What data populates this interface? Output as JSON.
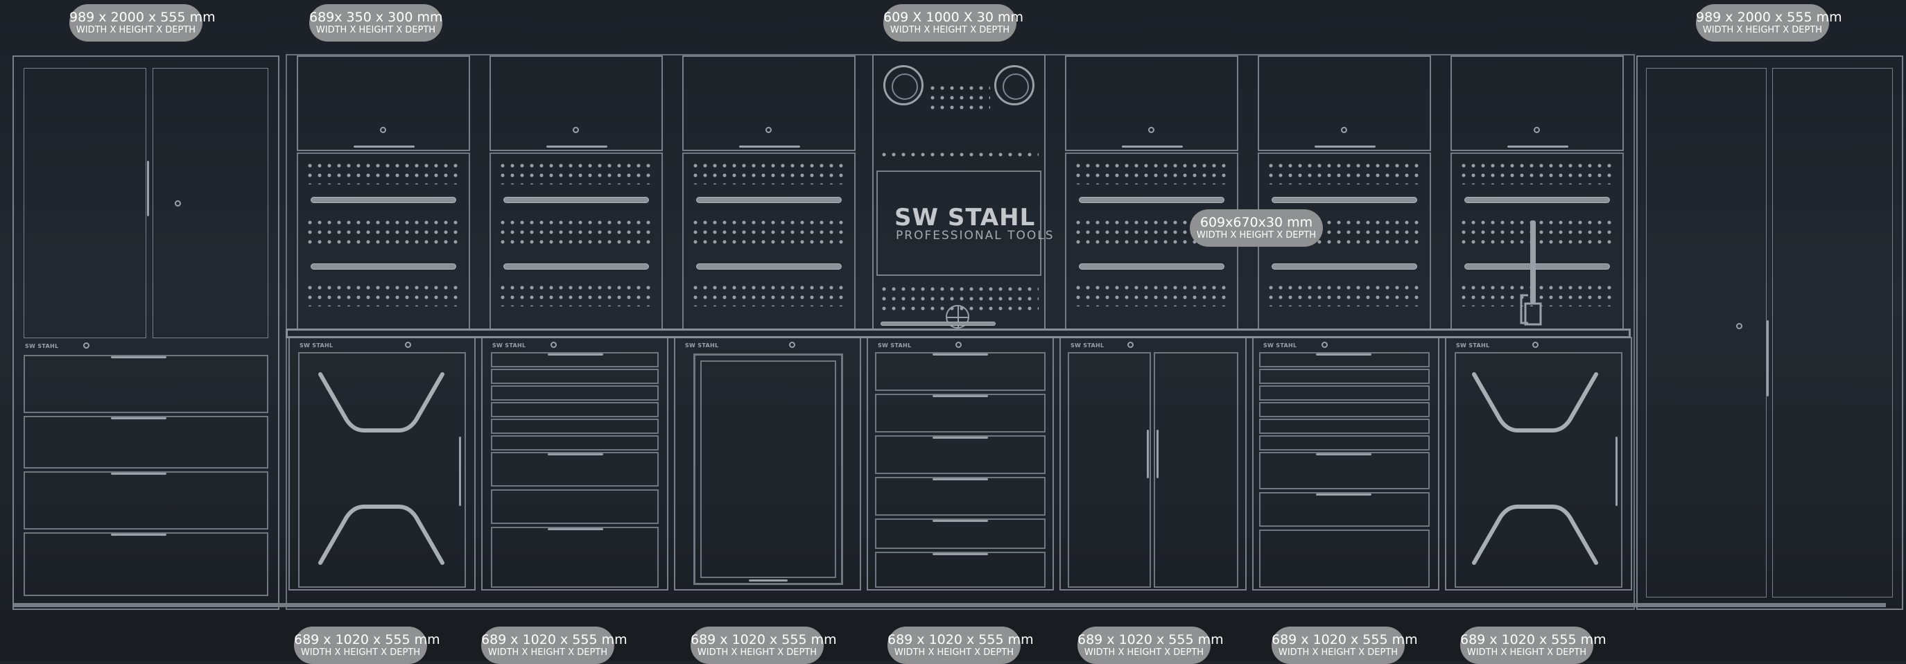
{
  "top_labels": [
    {
      "id": "tall-left",
      "main": "989 x 2000 x 555 mm",
      "sub": "WIDTH X HEIGHT X DEPTH"
    },
    {
      "id": "wall-cabinet",
      "main": "689x 350 x 300 mm",
      "sub": "WIDTH X HEIGHT X DEPTH"
    },
    {
      "id": "center-panel",
      "main": "609 X 1000 X 30 mm",
      "sub": "WIDTH X HEIGHT X DEPTH"
    },
    {
      "id": "tall-right",
      "main": "989 x 2000 x 555 mm",
      "sub": "WIDTH X HEIGHT X DEPTH"
    }
  ],
  "mid_label": {
    "main": "609x670x30 mm",
    "sub": "WIDTH X HEIGHT X DEPTH"
  },
  "bottom_labels": [
    {
      "main": "689 x 1020 x 555 mm",
      "sub": "WIDTH X HEIGHT X DEPTH"
    },
    {
      "main": "689 x 1020 x 555 mm",
      "sub": "WIDTH X HEIGHT X DEPTH"
    },
    {
      "main": "689 x 1020 x 555 mm",
      "sub": "WIDTH X HEIGHT X DEPTH"
    },
    {
      "main": "689 x 1020 x 555 mm",
      "sub": "WIDTH X HEIGHT X DEPTH"
    },
    {
      "main": "689 x 1020 x 555 mm",
      "sub": "WIDTH X HEIGHT X DEPTH"
    },
    {
      "main": "689 x 1020 x 555 mm",
      "sub": "WIDTH X HEIGHT X DEPTH"
    },
    {
      "main": "689 x 1020 x 555 mm",
      "sub": "WIDTH X HEIGHT X DEPTH"
    }
  ],
  "brand_stamp": "SW STAHL",
  "center_logo": {
    "title": "SW STAHL",
    "subtitle": "PROFESSIONAL TOOLS"
  },
  "colors": {
    "background": "#1f242b",
    "line": "#7a8088",
    "label_pill": "#8f9193",
    "label_text": "#ffffff"
  }
}
